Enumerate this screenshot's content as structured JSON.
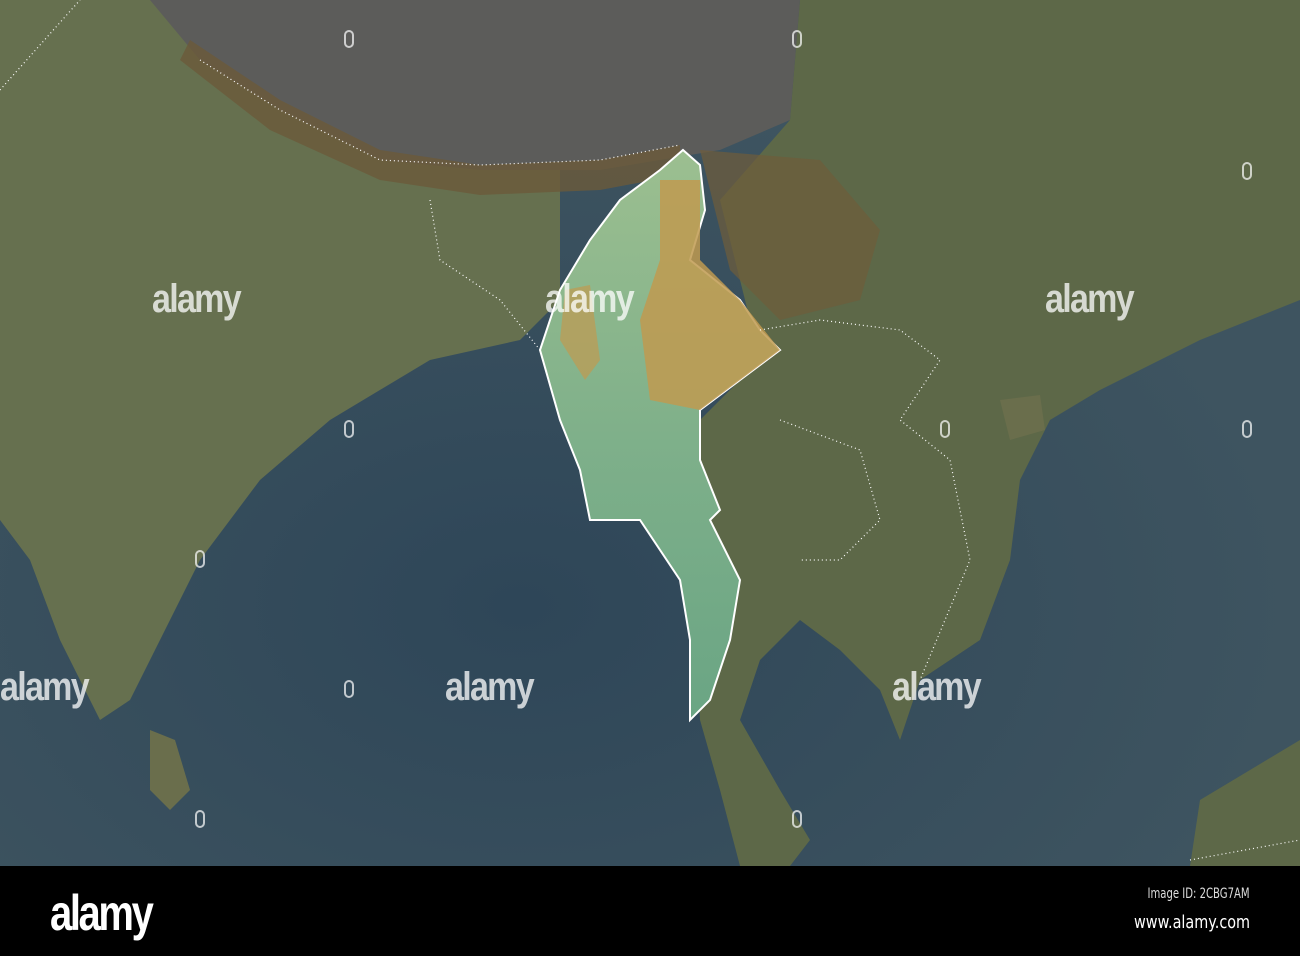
{
  "map": {
    "highlighted_country": "Myanmar",
    "colors": {
      "ocean": "#34495a",
      "land": "#5d6b4e",
      "plateau": "#5a5a58",
      "highlight": "#7fb08a",
      "highland": "#c09a50",
      "border": "#ffffff"
    }
  },
  "watermark": {
    "text": "alamy"
  },
  "footer": {
    "logo": "alamy",
    "image_id": "Image ID: 2CBG7AM",
    "url": "www.alamy.com"
  }
}
